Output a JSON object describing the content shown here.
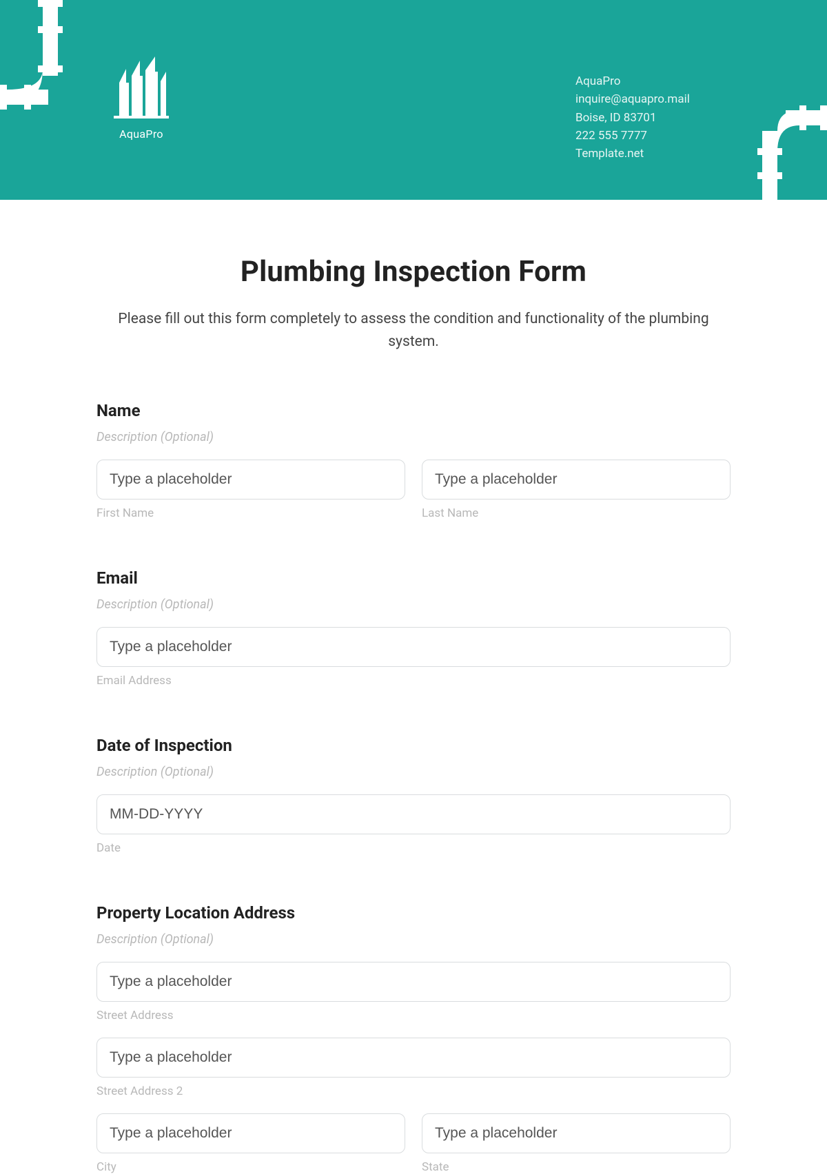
{
  "header": {
    "logo_caption": "AquaPro",
    "company": {
      "name": "AquaPro",
      "email": "inquire@aquapro.mail",
      "city_state_zip": "Boise, ID 83701",
      "phone": "222 555 7777",
      "website": "Template.net"
    }
  },
  "form": {
    "title": "Plumbing Inspection Form",
    "subtitle": "Please fill out this form completely to assess the condition and functionality of the plumbing system.",
    "desc_placeholder": "Description (Optional)",
    "sections": {
      "name": {
        "label": "Name",
        "first_placeholder": "Type a placeholder",
        "first_sub": "First Name",
        "last_placeholder": "Type a placeholder",
        "last_sub": "Last Name"
      },
      "email": {
        "label": "Email",
        "placeholder": "Type a placeholder",
        "sub": "Email Address"
      },
      "date": {
        "label": "Date of Inspection",
        "placeholder": "MM-DD-YYYY",
        "sub": "Date"
      },
      "address": {
        "label": "Property Location Address",
        "street_placeholder": "Type a placeholder",
        "street_sub": "Street Address",
        "street2_placeholder": "Type a placeholder",
        "street2_sub": "Street Address 2",
        "city_placeholder": "Type a placeholder",
        "city_sub": "City",
        "state_placeholder": "Type a placeholder",
        "state_sub": "State"
      }
    }
  }
}
